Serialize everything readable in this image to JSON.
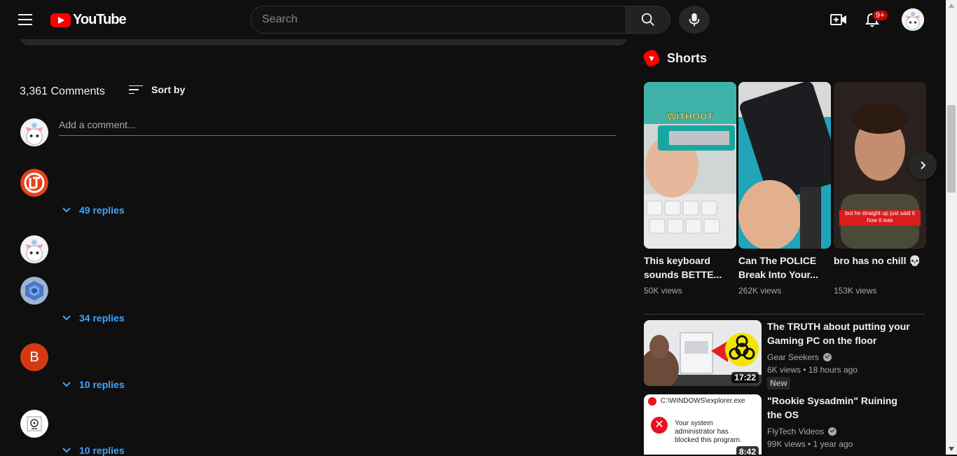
{
  "header": {
    "logo_text": "YouTube",
    "search_placeholder": "Search",
    "notification_count": "9+"
  },
  "comments": {
    "count_label": "3,361 Comments",
    "sort_label": "Sort by",
    "add_placeholder": "Add a comment...",
    "threads": [
      {
        "avatar": "lttstore-logo-avatar",
        "replies": "49 replies"
      },
      {
        "avatar": "anime-cat-avatar",
        "replies": ""
      },
      {
        "avatar": "blue-geometric-avatar",
        "replies": "34 replies"
      },
      {
        "avatar": "letter-b-avatar",
        "avatar_letter": "B",
        "replies": "10 replies"
      },
      {
        "avatar": "white-logo-avatar",
        "replies": "10 replies"
      }
    ]
  },
  "shorts": {
    "heading": "Shorts",
    "items": [
      {
        "title": "This keyboard sounds BETTE...",
        "views": "50K views",
        "overlay": "WITHOUT"
      },
      {
        "title": "Can The POLICE Break Into Your...",
        "views": "262K views",
        "overlay": ""
      },
      {
        "title": "bro has no chill 💀",
        "views": "153K views",
        "overlay": "but he straight up just said it how it was"
      }
    ]
  },
  "videos": [
    {
      "title": "The TRUTH about putting your Gaming PC on the floor",
      "channel": "Gear Seekers",
      "views": "6K views",
      "age": "18 hours ago",
      "duration": "17:22",
      "badge": "New"
    },
    {
      "title": "\"Rookie Sysadmin\" Ruining the OS",
      "channel": "FlyTech Videos",
      "views": "99K views",
      "age": "1 year ago",
      "duration": "8:42",
      "thumb_text": "C:\\WINDOWS\\explorer.exe",
      "thumb_msg": "Your system administrator has blocked this program."
    }
  ],
  "colors": {
    "background": "#0f0f0f",
    "accent_red": "#ff0000",
    "link_blue": "#3ea6ff"
  }
}
